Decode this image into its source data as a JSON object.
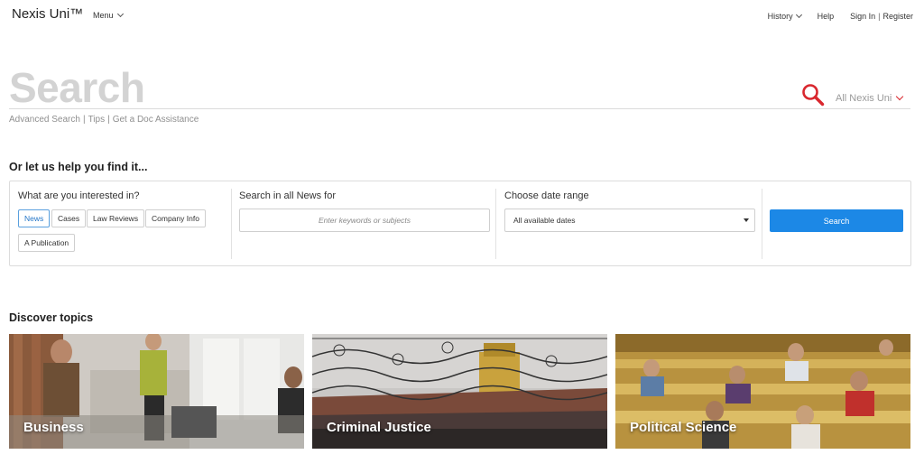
{
  "header": {
    "brand": "Nexis Uni™",
    "menu_label": "Menu",
    "history_label": "History",
    "help_label": "Help",
    "sign_in_label": "Sign In",
    "register_label": "Register",
    "signin_separator": "|"
  },
  "search": {
    "big_label": "Search",
    "scope_label": "All Nexis Uni",
    "links": [
      "Advanced Search",
      "Tips",
      "Get a Doc Assistance"
    ],
    "link_separator": "|"
  },
  "help": {
    "title": "Or let us help you find it...",
    "interest_title": "What are you interested in?",
    "chips": [
      "News",
      "Cases",
      "Law Reviews",
      "Company Info",
      "A Publication"
    ],
    "active_chip": "News",
    "keywords_title": "Search in all News for",
    "keywords_placeholder": "Enter keywords or subjects",
    "date_title": "Choose date range",
    "date_selected": "All available dates",
    "search_button": "Search"
  },
  "discover": {
    "title": "Discover topics",
    "topics": [
      "Business",
      "Criminal Justice",
      "Political Science"
    ]
  },
  "colors": {
    "accent_blue": "#1c88e6",
    "search_icon_red": "#d9272e"
  }
}
